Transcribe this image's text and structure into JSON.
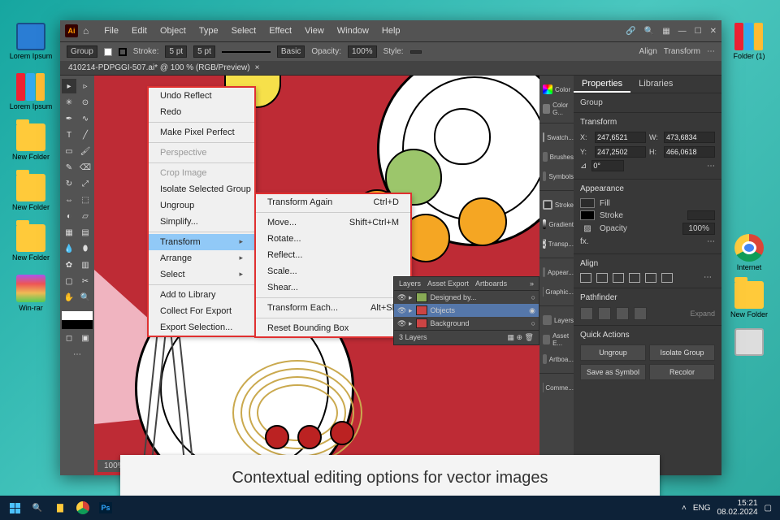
{
  "desktop": {
    "left": [
      {
        "label": "Lorem Ipsum",
        "icon": "monitor"
      },
      {
        "label": "Lorem Ipsum",
        "icon": "binders"
      },
      {
        "label": "New Folder",
        "icon": "folder"
      },
      {
        "label": "New Folder",
        "icon": "folder"
      },
      {
        "label": "New Folder",
        "icon": "folder"
      },
      {
        "label": "Win-rar",
        "icon": "winrar"
      }
    ],
    "right": [
      {
        "label": "Folder (1)",
        "icon": "binders"
      },
      {
        "label": "Internet",
        "icon": "chrome"
      },
      {
        "label": "New Folder",
        "icon": "folder"
      },
      {
        "label": "",
        "icon": "trash"
      }
    ]
  },
  "ai": {
    "menus": [
      "File",
      "Edit",
      "Object",
      "Type",
      "Select",
      "Effect",
      "View",
      "Window",
      "Help"
    ],
    "control": {
      "mode": "Group",
      "strokeLabel": "Stroke:",
      "strokePt": "5 pt",
      "uniform": "5 pt",
      "basic": "Basic",
      "opacityLabel": "Opacity:",
      "opacity": "100%",
      "styleLabel": "Style:",
      "alignLabel": "Align",
      "transformLabel": "Transform"
    },
    "docTab": "410214-PDPGGI-507.ai* @ 100 % (RGB/Preview)",
    "zoom": "100%",
    "ctx1": [
      {
        "label": "Undo Reflect"
      },
      {
        "label": "Redo"
      },
      {
        "sep": true
      },
      {
        "label": "Make Pixel Perfect"
      },
      {
        "sep": true
      },
      {
        "label": "Perspective",
        "disabled": true
      },
      {
        "sep": true
      },
      {
        "label": "Crop Image",
        "disabled": true
      },
      {
        "label": "Isolate Selected Group"
      },
      {
        "label": "Ungroup"
      },
      {
        "label": "Simplify..."
      },
      {
        "sep": true
      },
      {
        "label": "Transform",
        "sub": true,
        "hl": true
      },
      {
        "label": "Arrange",
        "sub": true
      },
      {
        "label": "Select",
        "sub": true
      },
      {
        "sep": true
      },
      {
        "label": "Add to Library"
      },
      {
        "label": "Collect For Export",
        "sub": true
      },
      {
        "label": "Export Selection..."
      }
    ],
    "ctx2": [
      {
        "label": "Transform Again",
        "accel": "Ctrl+D"
      },
      {
        "sep": true
      },
      {
        "label": "Move...",
        "accel": "Shift+Ctrl+M"
      },
      {
        "label": "Rotate..."
      },
      {
        "label": "Reflect..."
      },
      {
        "label": "Scale..."
      },
      {
        "label": "Shear..."
      },
      {
        "sep": true
      },
      {
        "label": "Transform Each...",
        "accel": "Alt+Shift+Ctrl+D"
      },
      {
        "sep": true
      },
      {
        "label": "Reset Bounding Box"
      }
    ],
    "midcol": [
      "Color",
      "Color G...",
      "Swatch...",
      "Brushes",
      "Symbols",
      "Stroke",
      "Gradient",
      "Transp...",
      "Appear...",
      "Graphic...",
      "Layers",
      "Asset E...",
      "Artboa...",
      "Comme..."
    ],
    "layersPanel": {
      "tabs": [
        "Layers",
        "Asset Export",
        "Artboards"
      ],
      "rows": [
        "Designed by...",
        "Objects",
        "Background"
      ],
      "footer": "3 Layers"
    },
    "properties": {
      "tabs": [
        "Properties",
        "Libraries"
      ],
      "mode": "Group",
      "transform": {
        "title": "Transform",
        "x": "247,6521",
        "y": "247,2502",
        "w": "473,6834",
        "h": "466,0618",
        "angle": "0°"
      },
      "appearance": {
        "title": "Appearance",
        "fill": "Fill",
        "stroke": "Stroke",
        "opacity": "Opacity",
        "opVal": "100%",
        "fx": "fx."
      },
      "align": {
        "title": "Align"
      },
      "pathfinder": {
        "title": "Pathfinder",
        "expand": "Expand"
      },
      "quick": {
        "title": "Quick Actions",
        "ungroup": "Ungroup",
        "isolate": "Isolate Group",
        "saveSym": "Save as Symbol",
        "recolor": "Recolor"
      }
    }
  },
  "caption": "Contextual editing options for vector images",
  "taskbar": {
    "lang": "ENG",
    "time": "15:21",
    "date": "08.02.2024"
  }
}
